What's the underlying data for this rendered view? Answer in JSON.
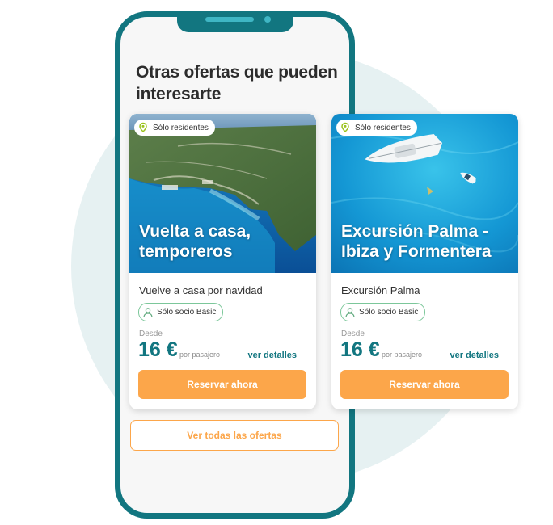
{
  "section": {
    "title": "Otras ofertas que pueden interesarte"
  },
  "cards": [
    {
      "location_badge": "Sólo residentes",
      "headline": "Vuelta a casa, temporeros",
      "subtitle": "Vuelve a casa por navidad",
      "member_badge": "Sólo socio Basic",
      "from_label": "Desde",
      "price": "16 €",
      "price_unit": "por pasajero",
      "details_link": "ver detalles",
      "book_button": "Reservar ahora"
    },
    {
      "location_badge": "Sólo residentes",
      "headline": "Excursión Palma - Ibiza y Formentera",
      "subtitle": "Excursión Palma",
      "member_badge": "Sólo socio Basic",
      "from_label": "Desde",
      "price": "16 €",
      "price_unit": "por pasajero",
      "details_link": "ver detalles",
      "book_button": "Reservar ahora"
    }
  ],
  "all_offers_button": "Ver todas las ofertas",
  "colors": {
    "brand": "#127680",
    "accent": "#fca64a",
    "member_badge_border": "#7cc79a",
    "background_circle": "#e6f1f2"
  },
  "icons": {
    "location": "map-pin-icon",
    "member": "person-icon"
  }
}
